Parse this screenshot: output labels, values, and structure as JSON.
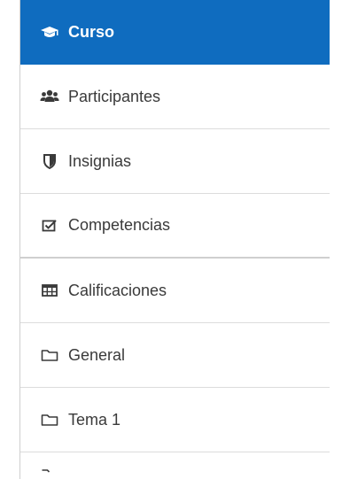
{
  "nav": {
    "items": [
      {
        "label": "Curso",
        "icon": "graduation-cap-icon",
        "active": true
      },
      {
        "label": "Participantes",
        "icon": "users-icon"
      },
      {
        "label": "Insignias",
        "icon": "shield-icon"
      },
      {
        "label": "Competencias",
        "icon": "checkbox-icon"
      },
      {
        "label": "Calificaciones",
        "icon": "table-icon"
      },
      {
        "label": "General",
        "icon": "folder-icon"
      },
      {
        "label": "Tema 1",
        "icon": "folder-icon"
      }
    ]
  },
  "colors": {
    "active_bg": "#0f6cbf",
    "active_text": "#ffffff",
    "text": "#3a3a3a",
    "divider": "#dcdcdc"
  }
}
